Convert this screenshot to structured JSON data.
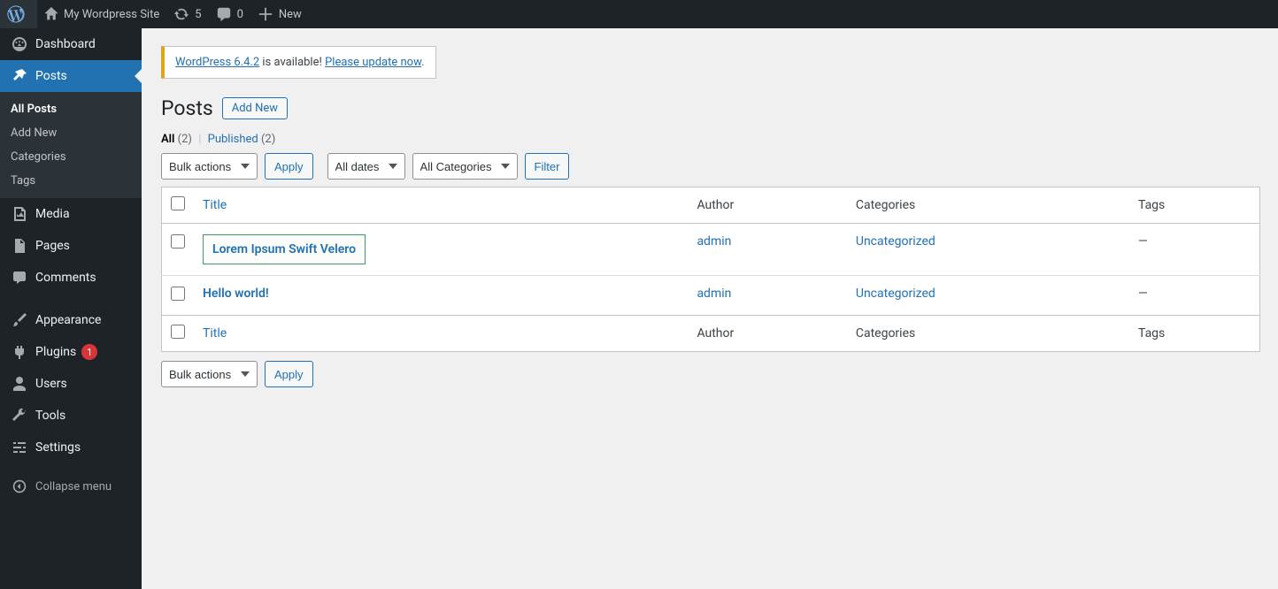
{
  "adminbar": {
    "site_name": "My Wordpress Site",
    "updates_count": "5",
    "comments_count": "0",
    "new_label": "New"
  },
  "sidebar": {
    "dashboard": "Dashboard",
    "posts": "Posts",
    "posts_submenu": {
      "all_posts": "All Posts",
      "add_new": "Add New",
      "categories": "Categories",
      "tags": "Tags"
    },
    "media": "Media",
    "pages": "Pages",
    "comments": "Comments",
    "appearance": "Appearance",
    "plugins": "Plugins",
    "plugins_badge": "1",
    "users": "Users",
    "tools": "Tools",
    "settings": "Settings",
    "collapse": "Collapse menu"
  },
  "notice": {
    "version_link": "WordPress 6.4.2",
    "mid_text": " is available! ",
    "update_link": "Please update now"
  },
  "header": {
    "title": "Posts",
    "add_new": "Add New"
  },
  "views": {
    "all_label": "All",
    "all_count": "(2)",
    "published_label": "Published",
    "published_count": "(2)"
  },
  "filters": {
    "bulk_actions": "Bulk actions",
    "apply": "Apply",
    "all_dates": "All dates",
    "all_categories": "All Categories",
    "filter": "Filter"
  },
  "table": {
    "col_title": "Title",
    "col_author": "Author",
    "col_categories": "Categories",
    "col_tags": "Tags",
    "rows": [
      {
        "title": "Lorem Ipsum Swift Velero",
        "author": "admin",
        "category": "Uncategorized",
        "tags": "—",
        "highlighted": true
      },
      {
        "title": "Hello world!",
        "author": "admin",
        "category": "Uncategorized",
        "tags": "—",
        "highlighted": false
      }
    ]
  }
}
